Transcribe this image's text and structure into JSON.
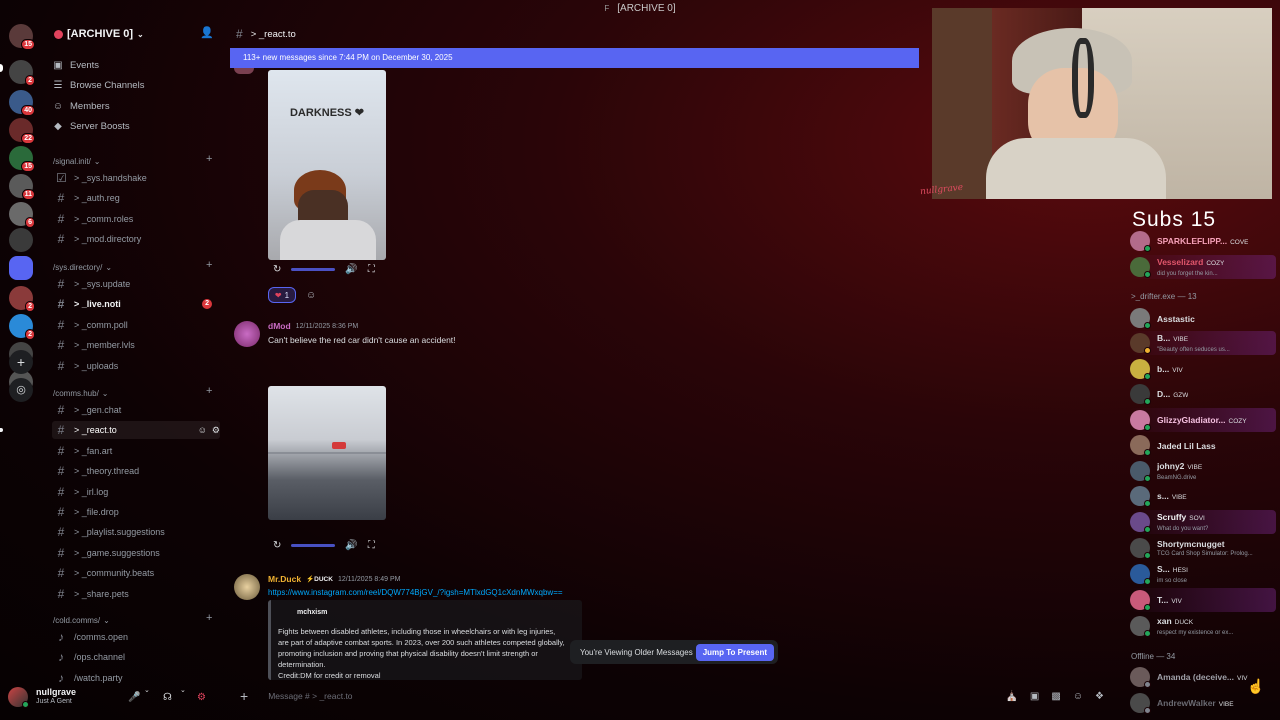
{
  "window": {
    "title": "[ARCHIVE 0]",
    "app_glyph": "F"
  },
  "rail": {
    "badges": [
      "15",
      "2",
      "40",
      "22",
      "15",
      "11",
      "6",
      "2",
      "2"
    ]
  },
  "guild": {
    "name": "[ARCHIVE 0]"
  },
  "nav": [
    {
      "label": "Events",
      "icon": "calendar-icon"
    },
    {
      "label": "Browse Channels",
      "icon": "list-icon"
    },
    {
      "label": "Members",
      "icon": "members-icon"
    },
    {
      "label": "Server Boosts",
      "icon": "boost-icon"
    }
  ],
  "categories": [
    {
      "name": "/signal.init/",
      "channels": [
        {
          "label": "> _sys.handshake",
          "icon": "rules-icon"
        },
        {
          "label": "> _auth.reg"
        },
        {
          "label": "> _comm.roles"
        },
        {
          "label": "> _mod.directory"
        }
      ]
    },
    {
      "name": "/sys.directory/",
      "channels": [
        {
          "label": "> _sys.update"
        },
        {
          "label": "> _live.noti",
          "unread": true,
          "mentions": "2"
        },
        {
          "label": "> _comm.poll"
        },
        {
          "label": "> _member.lvls"
        },
        {
          "label": "> _uploads"
        }
      ]
    },
    {
      "name": "/comms.hub/",
      "channels": [
        {
          "label": "> _gen.chat"
        },
        {
          "label": "> _react.to",
          "active": true
        },
        {
          "label": "> _fan.art"
        },
        {
          "label": "> _theory.thread"
        },
        {
          "label": "> _irl.log"
        },
        {
          "label": "> _file.drop"
        },
        {
          "label": "> _playlist.suggestions"
        },
        {
          "label": "> _game.suggestions"
        },
        {
          "label": "> _community.beats"
        },
        {
          "label": "> _share.pets"
        }
      ]
    },
    {
      "name": "/cold.comms/",
      "channels": [
        {
          "label": "/comms.open",
          "voice": true
        },
        {
          "label": "/ops.channel",
          "voice": true
        },
        {
          "label": "/watch.party",
          "voice": true
        }
      ]
    }
  ],
  "user": {
    "name": "nullgrave",
    "status": "Just A Gent"
  },
  "channel_header": {
    "name": "> _react.to"
  },
  "new_messages_bar": "113+ new messages since 7:44 PM on December 30, 2025",
  "messages": [
    {
      "media_caption": "DARKNESS ❤",
      "reaction": {
        "emoji": "❤",
        "count": "1"
      }
    },
    {
      "author": "dMod",
      "author_color": "#c96cc4",
      "timestamp": "12/11/2025 8:36 PM",
      "text": "Can't believe the red car didn't cause an accident!"
    },
    {
      "author": "Mr.Duck",
      "author_color": "#f0b232",
      "tag": "⚡DUCK",
      "timestamp": "12/11/2025 8:49 PM",
      "link": "https://www.instagram.com/reel/DQW774BjGV_/?igsh=MTlxdGQ1cXdnMWxqbw==",
      "embed": {
        "author": "mchxism",
        "description": "Fights between disabled athletes, including those in wheelchairs or with leg injuries, are part of adaptive combat sports. In 2023, over 200 such athletes competed globally, promoting inclusion and proving that physical disability doesn't limit strength or determination.",
        "credit": "Credit:DM for credit or removal"
      }
    }
  ],
  "older_banner": {
    "text": "You're Viewing Older Messages",
    "button": "Jump To Present"
  },
  "composer": {
    "placeholder": "Message # > _react.to"
  },
  "webcam": {
    "signature": "nullgrave"
  },
  "subs": {
    "label": "Subs",
    "count": "15"
  },
  "members": [
    {
      "name": "SPARKLEFLIPP...",
      "tag": "COVE",
      "color": "#f5a0b8",
      "avatar": "#b36b8a",
      "status": "#23a55a"
    },
    {
      "name": "Vesselizard",
      "tag": "COZY",
      "sub": "did you forget the kin...",
      "color": "#e2576c",
      "avatar": "#4a6a3a",
      "status": "#23a55a",
      "boost": true
    }
  ],
  "member_groups": [
    {
      "label": ">_drifter.exe — 13"
    },
    {
      "label": "Offline — 34"
    }
  ],
  "drifters": [
    {
      "name": "Asstastic",
      "color": "#dbdee1",
      "avatar": "#7a7a7a",
      "status": "#23a55a"
    },
    {
      "name": "B...",
      "tag": "VIBE",
      "sub": "\"Beauty often seduces us...",
      "color": "#dbdee1",
      "avatar": "#5a3a2a",
      "status": "#f0b232",
      "boost": true
    },
    {
      "name": "b...",
      "tag": "VIV",
      "color": "#dbdee1",
      "avatar": "#c9b040",
      "status": "#23a55a"
    },
    {
      "name": "D...",
      "tag": "GZW",
      "color": "#dbdee1",
      "avatar": "#3a3a3a",
      "status": "#23a55a"
    },
    {
      "name": "GlizzyGladiator...",
      "tag": "COZY",
      "color": "#f5c0e0",
      "avatar": "#c97aa0",
      "status": "#23a55a",
      "boost": true
    },
    {
      "name": "Jaded Lil Lass",
      "color": "#dbdee1",
      "avatar": "#8a6a5a",
      "status": "#23a55a"
    },
    {
      "name": "johny2",
      "tag": "VIBE",
      "sub": "BeamNG.drive",
      "color": "#dbdee1",
      "avatar": "#4a5a6a",
      "status": "#23a55a"
    },
    {
      "name": "s...",
      "tag": "VIBE",
      "color": "#dbdee1",
      "avatar": "#5a6a7a",
      "status": "#23a55a"
    },
    {
      "name": "Scruffy",
      "tag": "SOVI",
      "sub": "What do you want?",
      "color": "#f2f3f5",
      "avatar": "#6a4a8a",
      "status": "#23a55a",
      "boost": true
    },
    {
      "name": "Shortymcnugget",
      "sub": "TCG Card Shop Simulator: Prolog...",
      "color": "#dbdee1",
      "avatar": "#4a4a4a",
      "status": "#23a55a"
    },
    {
      "name": "S...",
      "tag": "HESI",
      "sub": "im so close",
      "color": "#dbdee1",
      "avatar": "#2a5a9a",
      "status": "#23a55a"
    },
    {
      "name": "T...",
      "tag": "VIV",
      "color": "#dbdee1",
      "avatar": "#c95a7a",
      "status": "#23a55a",
      "boost": true
    },
    {
      "name": "xan",
      "tag": "DUCK",
      "sub": "respect my existence or ex...",
      "color": "#dbdee1",
      "avatar": "#5a5a5a",
      "status": "#23a55a"
    }
  ],
  "offline": [
    {
      "name": "Amanda (deceive...",
      "tag": "VIV",
      "color": "#a0a0a8",
      "avatar": "#6a5a5a",
      "status": "#80848e"
    },
    {
      "name": "AndrewWalker",
      "tag": "VIBE",
      "color": "#6a6a72",
      "avatar": "#4a4a4a",
      "status": "#80848e"
    }
  ]
}
